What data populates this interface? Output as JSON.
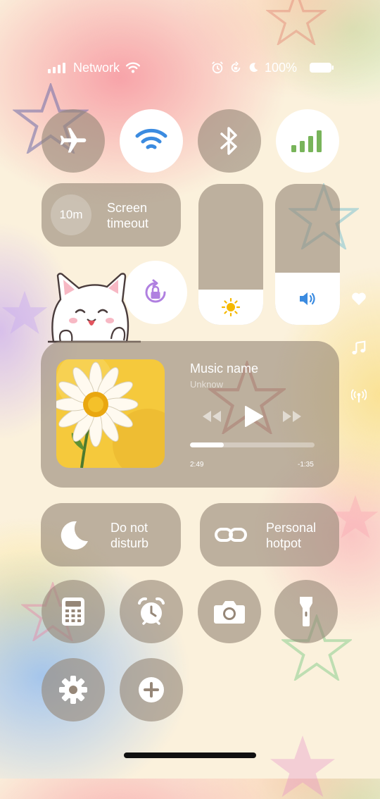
{
  "status_bar": {
    "carrier": "Network",
    "battery_text": "100%",
    "icons": [
      "signal-icon",
      "wifi-icon",
      "alarm-icon",
      "rotation-lock-icon",
      "moon-icon",
      "battery-icon"
    ]
  },
  "quick_toggles": [
    {
      "name": "airplane-mode",
      "icon": "airplane-icon",
      "active": false
    },
    {
      "name": "wifi",
      "icon": "wifi-icon",
      "active": true
    },
    {
      "name": "bluetooth",
      "icon": "bluetooth-icon",
      "active": false
    },
    {
      "name": "mobile-data",
      "icon": "cellular-icon",
      "active": true
    }
  ],
  "screen_timeout": {
    "value": "10m",
    "label": "Screen timeout"
  },
  "rotation_lock": {
    "icon": "rotation-lock-icon",
    "active": true
  },
  "sliders": {
    "brightness": {
      "icon": "sun-icon",
      "level": 0.25
    },
    "volume": {
      "icon": "speaker-icon",
      "level": 0.37
    }
  },
  "media": {
    "title": "Music name",
    "artist": "Unknow",
    "elapsed": "2:49",
    "remaining": "-1:35",
    "progress": 0.27,
    "controls": [
      "rewind-icon",
      "play-icon",
      "fast-forward-icon"
    ]
  },
  "dnd": {
    "label": "Do not disturb"
  },
  "hotspot": {
    "label": "Personal hotpot"
  },
  "shortcuts": [
    "calculator-icon",
    "alarm-clock-icon",
    "camera-icon",
    "flashlight-icon",
    "settings-icon",
    "add-icon"
  ],
  "side_icons": [
    "heart-icon",
    "music-note-icon",
    "broadcast-icon"
  ],
  "colors": {
    "tile": "#968778",
    "accent_blue": "#3b8be0",
    "accent_green": "#78b45a",
    "accent_purple": "#b080e0",
    "sun_yellow": "#f5b800"
  }
}
